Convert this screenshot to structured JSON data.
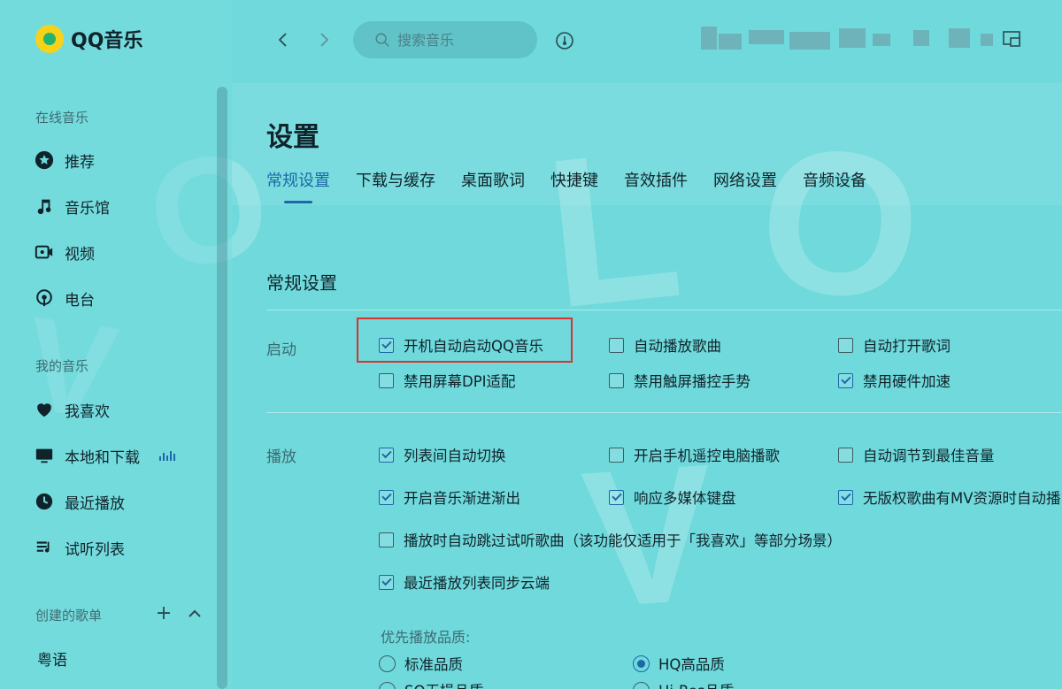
{
  "app": {
    "name": "QQ音乐"
  },
  "sidebar": {
    "sections": {
      "online": "在线音乐",
      "mine": "我的音乐",
      "created": "创建的歌单"
    },
    "online_items": [
      {
        "label": "推荐",
        "icon": "star-icon"
      },
      {
        "label": "音乐馆",
        "icon": "music-note-icon"
      },
      {
        "label": "视频",
        "icon": "video-icon"
      },
      {
        "label": "电台",
        "icon": "radio-icon"
      }
    ],
    "mine_items": [
      {
        "label": "我喜欢",
        "icon": "heart-icon"
      },
      {
        "label": "本地和下载",
        "icon": "monitor-icon"
      },
      {
        "label": "最近播放",
        "icon": "clock-icon"
      },
      {
        "label": "试听列表",
        "icon": "playlist-icon"
      }
    ],
    "playlists": [
      "粤语"
    ]
  },
  "search": {
    "placeholder": "搜索音乐"
  },
  "page": {
    "title": "设置",
    "tabs": [
      "常规设置",
      "下载与缓存",
      "桌面歌词",
      "快捷键",
      "音效插件",
      "网络设置",
      "音频设备"
    ],
    "active_tab": "常规设置",
    "section_title": "常规设置"
  },
  "startup": {
    "label": "启动",
    "options": [
      {
        "label": "开机自动启动QQ音乐",
        "checked": true
      },
      {
        "label": "自动播放歌曲",
        "checked": false
      },
      {
        "label": "自动打开歌词",
        "checked": false
      },
      {
        "label": "禁用屏幕DPI适配",
        "checked": false
      },
      {
        "label": "禁用触屏播控手势",
        "checked": false
      },
      {
        "label": "禁用硬件加速",
        "checked": true
      }
    ]
  },
  "playback": {
    "label": "播放",
    "options": [
      {
        "label": "列表间自动切换",
        "checked": true
      },
      {
        "label": "开启手机遥控电脑播歌",
        "checked": false
      },
      {
        "label": "自动调节到最佳音量",
        "checked": false
      },
      {
        "label": "开启音乐渐进渐出",
        "checked": true
      },
      {
        "label": "响应多媒体键盘",
        "checked": true
      },
      {
        "label": "无版权歌曲有MV资源时自动播",
        "checked": true
      },
      {
        "label": "播放时自动跳过试听歌曲（该功能仅适用于「我喜欢」等部分场景）",
        "checked": false
      },
      {
        "label": "最近播放列表同步云端",
        "checked": true
      }
    ],
    "quality_label": "优先播放品质:",
    "quality_options": [
      {
        "label": "标准品质",
        "checked": false
      },
      {
        "label": "HQ高品质",
        "checked": true
      },
      {
        "label": "SQ无损品质",
        "checked": false
      },
      {
        "label": "Hi-Res品质",
        "checked": false
      }
    ]
  },
  "colors": {
    "accent": "#1d68a7",
    "background": "#6fd9dc",
    "highlight": "#d8332e"
  }
}
